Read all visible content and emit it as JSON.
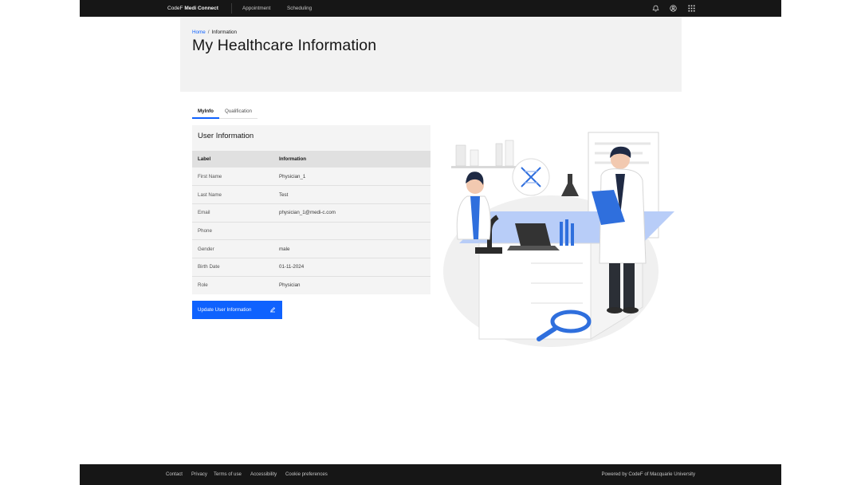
{
  "header": {
    "brand_prefix": "CodeF",
    "brand_name": "Medi Connect",
    "nav": [
      "Appointment",
      "Scheduling"
    ],
    "icons": [
      "notification-icon",
      "user-avatar-icon",
      "app-switcher-icon"
    ]
  },
  "banner": {
    "breadcrumb_home": "Home",
    "breadcrumb_separator": "/",
    "breadcrumb_current": "Information",
    "title": "My Healthcare Information"
  },
  "tabs": [
    {
      "label": "MyInfo",
      "active": true
    },
    {
      "label": "Qualification",
      "active": false
    }
  ],
  "card": {
    "title": "User Information",
    "columns": [
      "Label",
      "Information"
    ],
    "rows": [
      {
        "label": "First Name",
        "value": "Physician_1"
      },
      {
        "label": "Last Name",
        "value": "Test"
      },
      {
        "label": "Email",
        "value": "physician_1@medi-c.com"
      },
      {
        "label": "Phone",
        "value": ""
      },
      {
        "label": "Gender",
        "value": "male"
      },
      {
        "label": "Birth Date",
        "value": "01-11-2024"
      },
      {
        "label": "Role",
        "value": "Physician"
      }
    ]
  },
  "update_button": {
    "label": "Update User Information",
    "icon": "edit-icon"
  },
  "footer": {
    "links": [
      "Contact",
      "Privacy",
      "Terms of use",
      "Accessibility",
      "Cookie preferences"
    ],
    "powered_by": "Powered by CodeF of Macquarie University"
  },
  "colors": {
    "accent": "#0f62fe",
    "header_bg": "#161616",
    "banner_bg": "#f2f2f2"
  }
}
